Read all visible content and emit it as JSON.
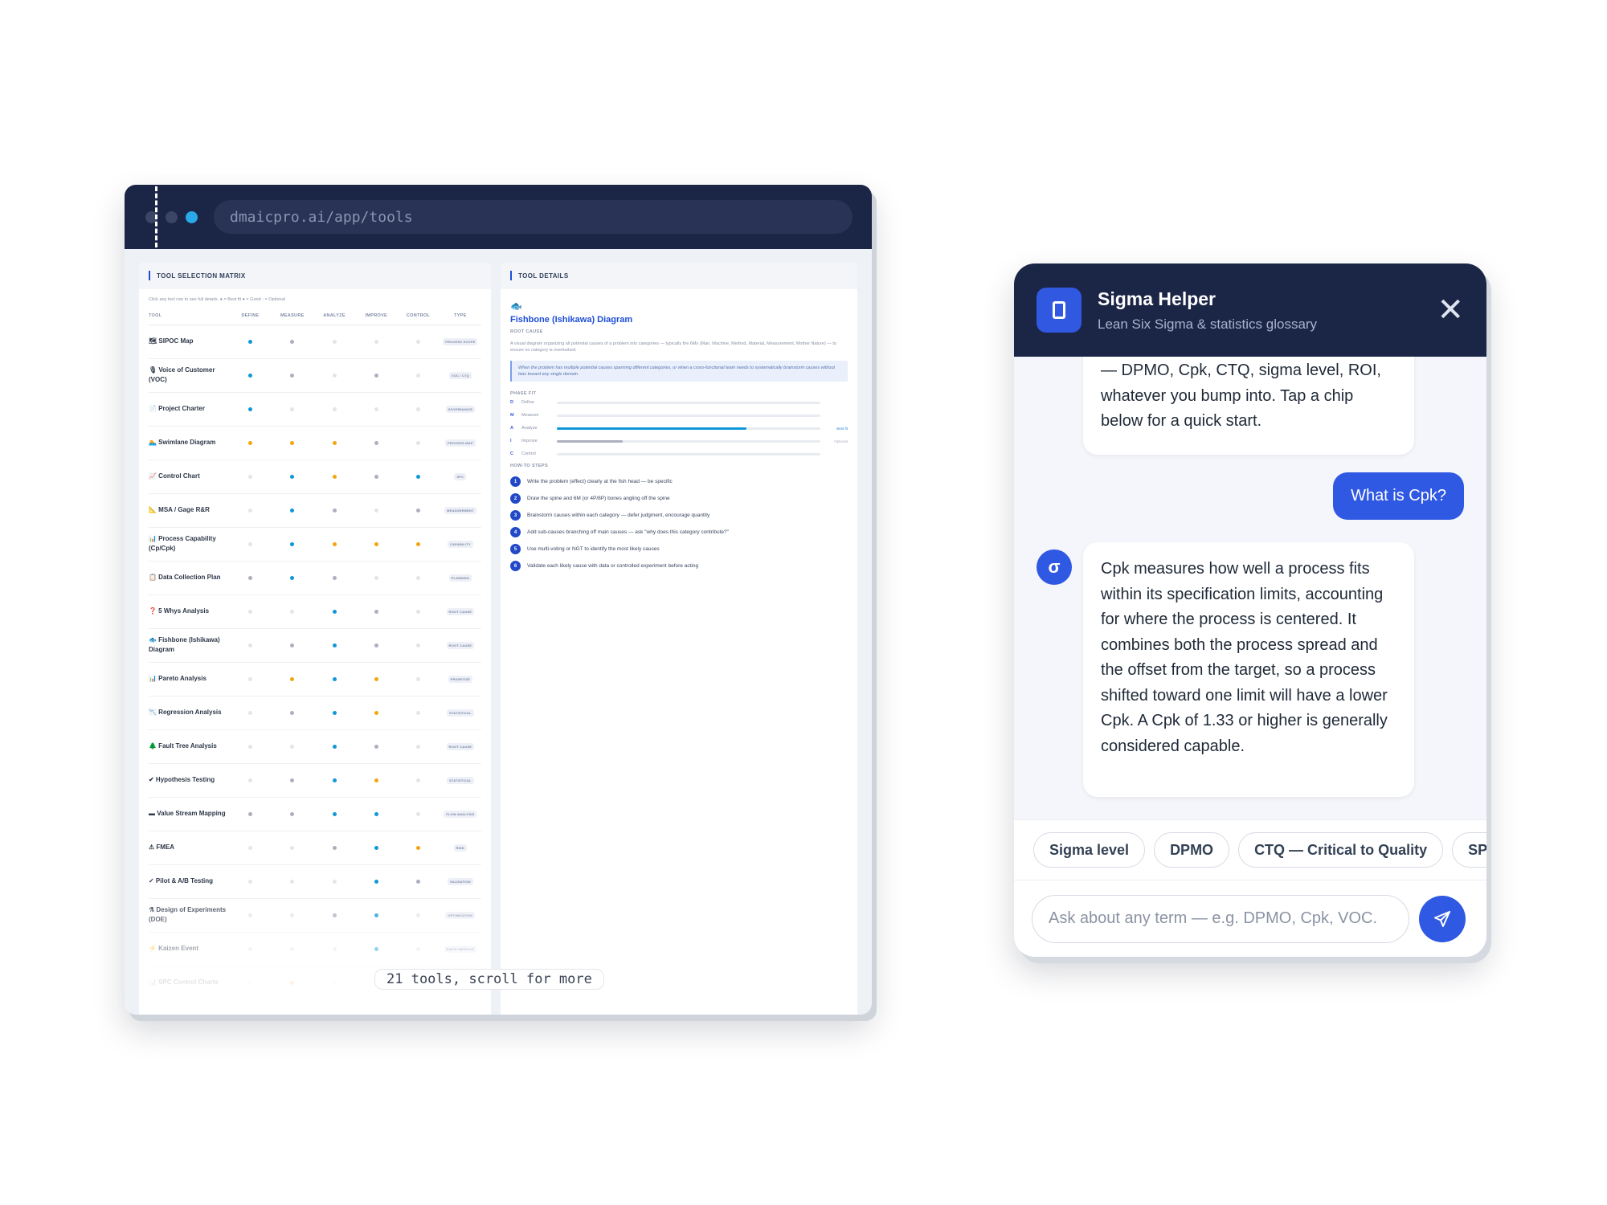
{
  "browser": {
    "url": "dmaicpro.ai/app/tools"
  },
  "matrix_panel": {
    "title": "TOOL SELECTION MATRIX",
    "hint": "Click any tool row to see full details. ● = Best fit ● = Good ◦ = Optional",
    "headers": {
      "tool": "TOOL",
      "define": "DEFINE",
      "measure": "MEASURE",
      "analyze": "ANALYZE",
      "improve": "IMPROVE",
      "control": "CONTROL",
      "type": "TYPE"
    },
    "rows": [
      {
        "name": "🗺 SIPOC Map",
        "fit": [
          "best",
          "opt",
          "none",
          "none",
          "none"
        ],
        "type": "PROCESS SCOPE"
      },
      {
        "name": "🎙 Voice of Customer (VOC)",
        "fit": [
          "best",
          "opt",
          "none",
          "opt",
          "none"
        ],
        "type": "VOC / CTQ"
      },
      {
        "name": "📄 Project Charter",
        "fit": [
          "best",
          "none",
          "none",
          "none",
          "none"
        ],
        "type": "GOVERNANCE"
      },
      {
        "name": "🏊 Swimlane Diagram",
        "fit": [
          "good",
          "good",
          "good",
          "opt",
          "none"
        ],
        "type": "PROCESS MAP"
      },
      {
        "name": "📈 Control Chart",
        "fit": [
          "none",
          "best",
          "good",
          "opt",
          "best"
        ],
        "type": "SPC"
      },
      {
        "name": "📐 MSA / Gage R&R",
        "fit": [
          "none",
          "best",
          "opt",
          "none",
          "opt"
        ],
        "type": "MEASUREMENT"
      },
      {
        "name": "📊 Process Capability (Cp/Cpk)",
        "fit": [
          "none",
          "best",
          "good",
          "good",
          "good"
        ],
        "type": "CAPABILITY"
      },
      {
        "name": "📋 Data Collection Plan",
        "fit": [
          "opt",
          "best",
          "opt",
          "none",
          "none"
        ],
        "type": "PLANNING"
      },
      {
        "name": "❓ 5 Whys Analysis",
        "fit": [
          "none",
          "none",
          "best",
          "opt",
          "none"
        ],
        "type": "ROOT CAUSE"
      },
      {
        "name": "🐟 Fishbone (Ishikawa) Diagram",
        "fit": [
          "none",
          "opt",
          "best",
          "opt",
          "none"
        ],
        "type": "ROOT CAUSE"
      },
      {
        "name": "📊 Pareto Analysis",
        "fit": [
          "none",
          "good",
          "best",
          "good",
          "none"
        ],
        "type": "PRIORITIZE"
      },
      {
        "name": "📉 Regression Analysis",
        "fit": [
          "none",
          "opt",
          "best",
          "good",
          "none"
        ],
        "type": "STATISTICAL"
      },
      {
        "name": "🌲 Fault Tree Analysis",
        "fit": [
          "none",
          "none",
          "best",
          "opt",
          "none"
        ],
        "type": "ROOT CAUSE"
      },
      {
        "name": "✔ Hypothesis Testing",
        "fit": [
          "none",
          "opt",
          "best",
          "good",
          "none"
        ],
        "type": "STATISTICAL"
      },
      {
        "name": "▬ Value Stream Mapping",
        "fit": [
          "opt",
          "opt",
          "best",
          "best",
          "none"
        ],
        "type": "FLOW ANALYSIS"
      },
      {
        "name": "⚠ FMEA",
        "fit": [
          "none",
          "none",
          "opt",
          "best",
          "good"
        ],
        "type": "RISK"
      },
      {
        "name": "✓ Pilot & A/B Testing",
        "fit": [
          "none",
          "none",
          "none",
          "best",
          "opt"
        ],
        "type": "VALIDATION"
      },
      {
        "name": "⚗ Design of Experiments (DOE)",
        "fit": [
          "none",
          "none",
          "opt",
          "best",
          "none"
        ],
        "type": "OPTIMIZATION"
      },
      {
        "name": "⚡ Kaizen Event",
        "fit": [
          "none",
          "none",
          "none",
          "best",
          "none"
        ],
        "type": "RAPID IMPROVE"
      },
      {
        "name": "📊 SPC Control Charts",
        "fit": [
          "none",
          "good",
          "none",
          "opt",
          "none"
        ],
        "type": ""
      }
    ],
    "scroll_note": "21 tools, scroll for more"
  },
  "details_panel": {
    "title": "TOOL DETAILS",
    "tool_name": "Fishbone (Ishikawa) Diagram",
    "category": "ROOT CAUSE",
    "description": "A visual diagram organizing all potential causes of a problem into categories — typically the 6Ms (Man, Machine, Method, Material, Measurement, Mother Nature) — to ensure no category is overlooked.",
    "when_to_use": "When the problem has multiple potential causes spanning different categories, or when a cross-functional team needs to systematically brainstorm causes without bias toward any single domain.",
    "phase_fit_label": "PHASE FIT",
    "phases": [
      {
        "letter": "D",
        "name": "Define",
        "level": 0,
        "label": ""
      },
      {
        "letter": "M",
        "name": "Measure",
        "level": 0,
        "label": ""
      },
      {
        "letter": "A",
        "name": "Analyze",
        "level": 0.72,
        "label": "Best fit"
      },
      {
        "letter": "I",
        "name": "Improve",
        "level": 0.25,
        "label": "Optional"
      },
      {
        "letter": "C",
        "name": "Control",
        "level": 0,
        "label": ""
      }
    ],
    "steps_label": "HOW-TO STEPS",
    "steps": [
      "Write the problem (effect) clearly at the fish head — be specific",
      "Draw the spine and 6M (or 4P/8P) bones angling off the spine",
      "Brainstorm causes within each category — defer judgment, encourage quantity",
      "Add sub-causes branching off main causes — ask \"why does this category contribute?\"",
      "Use multi-voting or NGT to identify the most likely causes",
      "Validate each likely cause with data or controlled experiment before acting"
    ]
  },
  "chat": {
    "title": "Sigma Helper",
    "subtitle": "Lean Six Sigma & statistics glossary",
    "bot_message_1": "— DPMO, Cpk, CTQ, sigma level, ROI, whatever you bump into. Tap a chip below for a quick start.",
    "user_message": "What is Cpk?",
    "avatar_letter": "σ",
    "bot_message_2": "Cpk measures how well a process fits within its specification limits, accounting for where the process is centered. It combines both the process spread and the offset from the target, so a process shifted toward one limit will have a lower Cpk. A Cpk of 1.33 or higher is generally considered capable.",
    "chips": [
      "Sigma level",
      "DPMO",
      "CTQ — Critical to Quality",
      "SPC"
    ],
    "input_placeholder": "Ask about any term — e.g. DPMO, Cpk, VOC."
  },
  "colors": {
    "navy": "#1b2546",
    "accent_blue": "#2f58e3",
    "best_fit": "#0f98d8",
    "good_fit": "#f3a50f",
    "optional_fit": "#aab0bd"
  }
}
